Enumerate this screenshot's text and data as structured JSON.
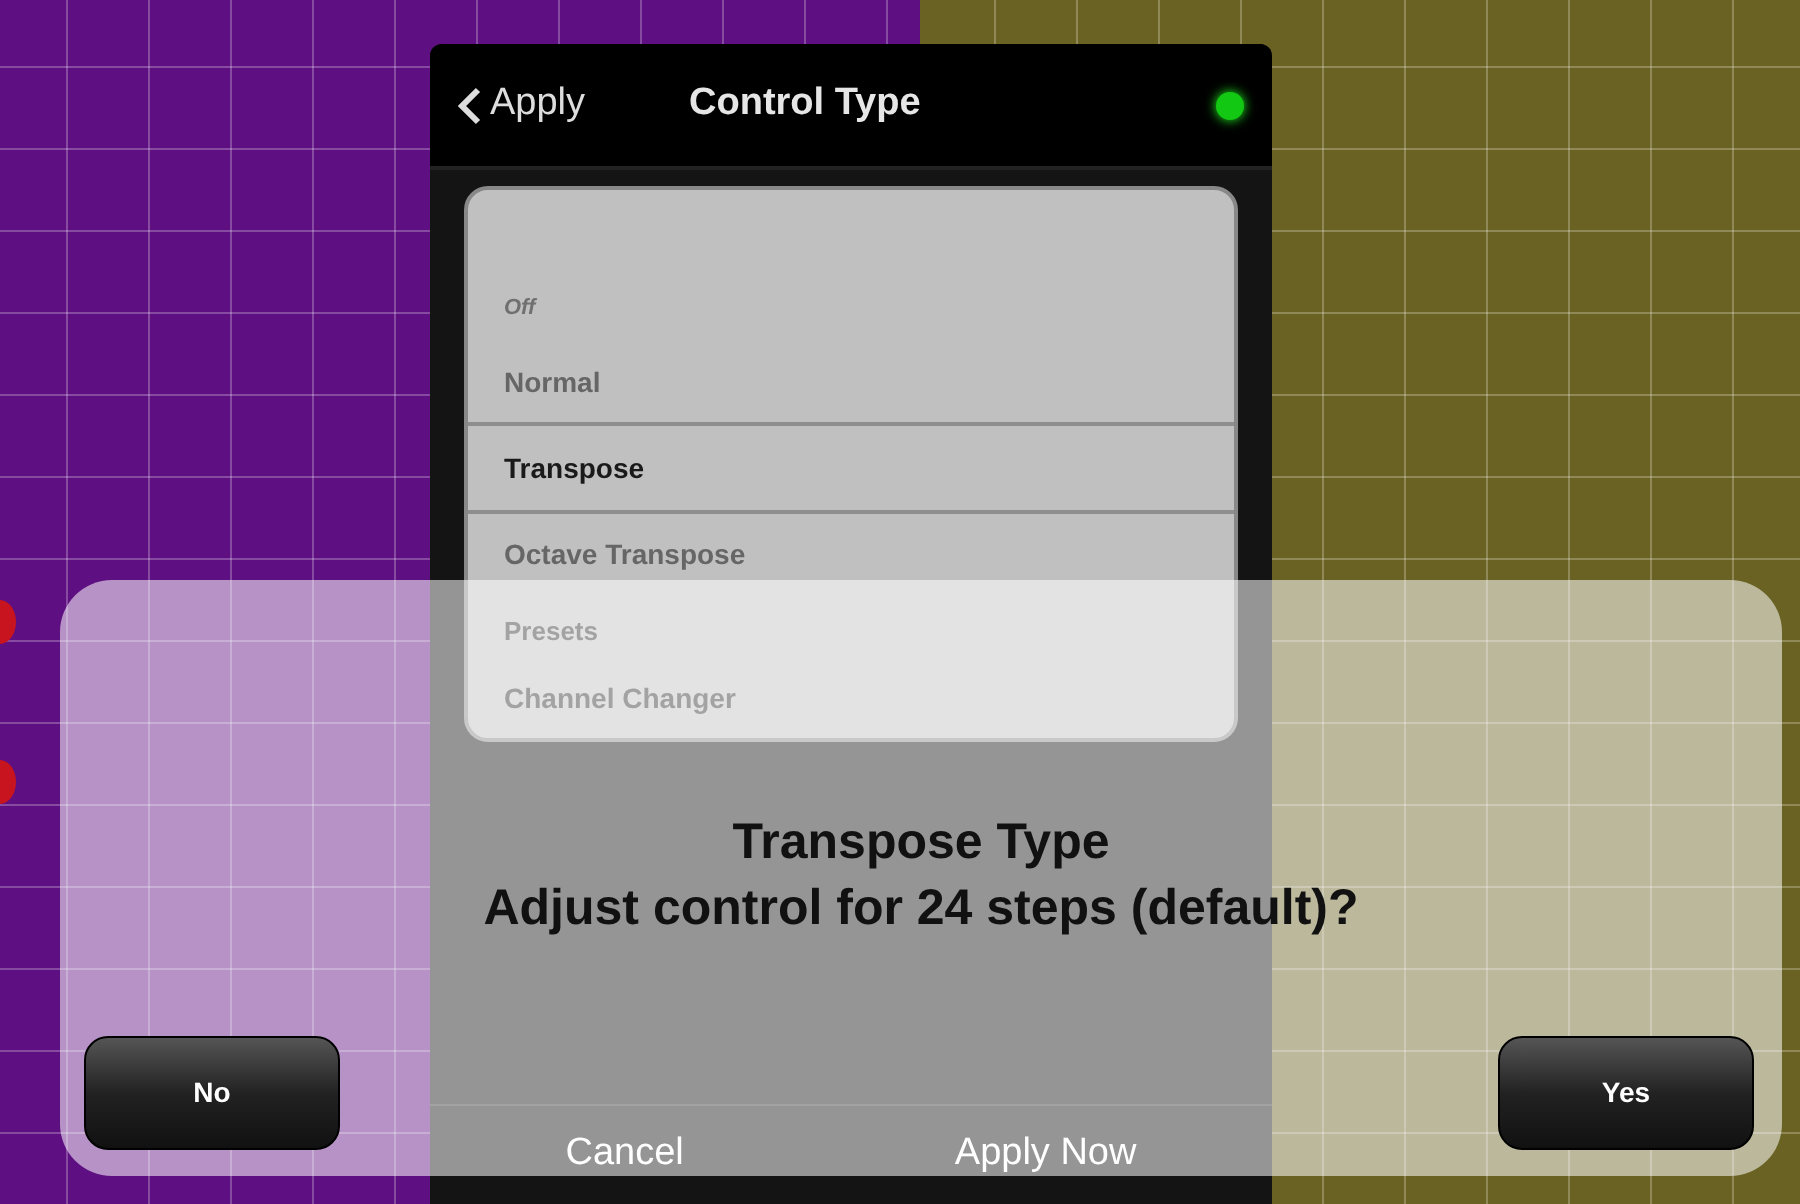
{
  "nav": {
    "back_label": "Apply",
    "title": "Control Type",
    "connected": true
  },
  "options": [
    {
      "label": "Off",
      "kind": "none",
      "selected": false
    },
    {
      "label": "Normal",
      "kind": "option",
      "selected": false
    },
    {
      "label": "Transpose",
      "kind": "option",
      "selected": true
    },
    {
      "label": "Octave Transpose",
      "kind": "option",
      "selected": false
    },
    {
      "label": "Presets",
      "kind": "header",
      "selected": false
    },
    {
      "label": "Channel Changer",
      "kind": "option",
      "selected": false
    }
  ],
  "footer_buttons": [
    "Cancel",
    "Apply Now"
  ],
  "alert": {
    "title": "Transpose Type",
    "message": "Adjust control for 24 steps (default)?",
    "buttons": [
      "No",
      "Yes"
    ]
  }
}
